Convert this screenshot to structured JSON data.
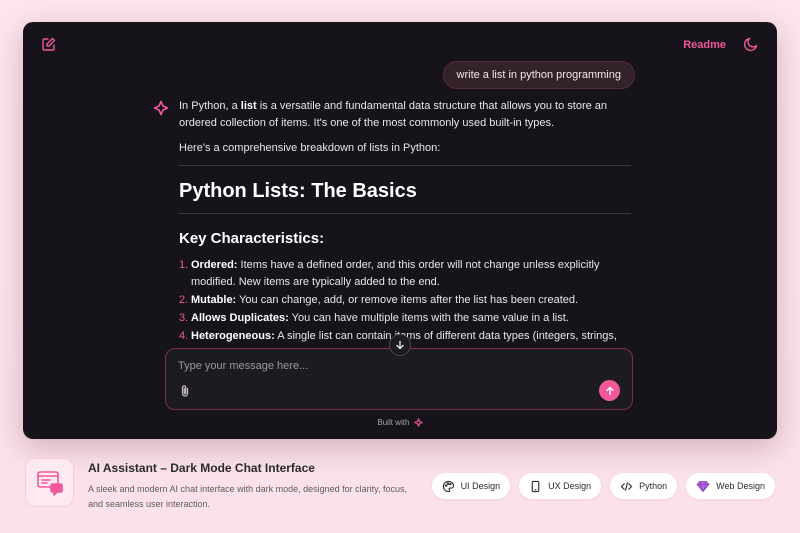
{
  "topbar": {
    "readme_label": "Readme"
  },
  "chat": {
    "user_message": "write a list in python programming",
    "intro_pre": "In Python, a ",
    "intro_bold": "list",
    "intro_post": " is a versatile and fundamental data structure that allows you to store an ordered collection of items. It's one of the most commonly used built-in types.",
    "breakdown": "Here's a comprehensive breakdown of lists in Python:",
    "heading": "Python Lists: The Basics",
    "subheading": "Key Characteristics:",
    "items": [
      {
        "num": "1.",
        "bold": "Ordered:",
        "text": " Items have a defined order, and this order will not change unless explicitly modified. New items are typically added to the end."
      },
      {
        "num": "2.",
        "bold": "Mutable:",
        "text": " You can change, add, or remove items after the list has been created."
      },
      {
        "num": "3.",
        "bold": "Allows Duplicates:",
        "text": " You can have multiple items with the same value in a list."
      },
      {
        "num": "4.",
        "bold": "Heterogeneous:",
        "text": " A single list can contain items of different data types (integers, strings,"
      }
    ]
  },
  "composer": {
    "placeholder": "Type your message here..."
  },
  "built_with": "Built with",
  "footer": {
    "title": "AI Assistant – Dark Mode Chat Interface",
    "description": "A sleek and modern AI chat interface with dark mode, designed for clarity, focus, and seamless user interaction.",
    "tags": [
      "UI Design",
      "UX Design",
      "Python",
      "Web Design"
    ]
  },
  "colors": {
    "accent": "#f0589a",
    "window_bg": "#16141a",
    "page_bg": "#fde6ee"
  }
}
